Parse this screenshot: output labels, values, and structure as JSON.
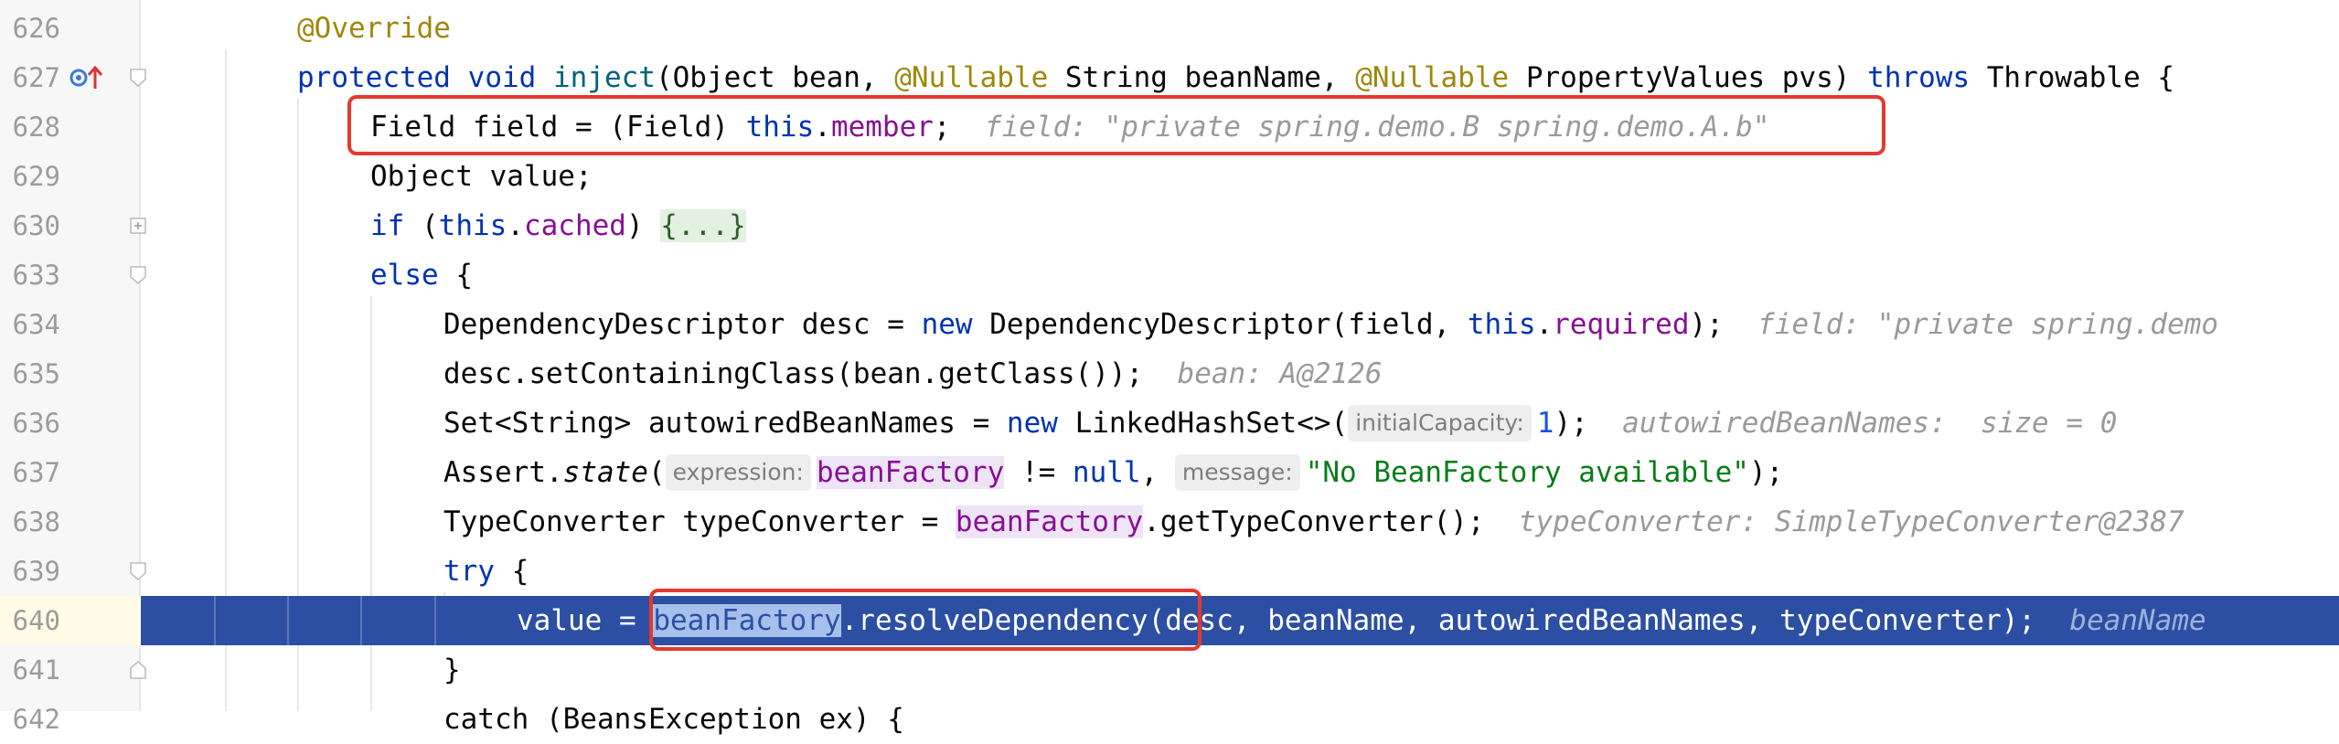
{
  "editor": {
    "lines": [
      {
        "num": "626",
        "text": "@Override"
      },
      {
        "num": "627",
        "kw1": "protected",
        "kw2": "void",
        "method": "inject",
        "p1": "(Object bean, ",
        "ann1": "@Nullable",
        "p2": " String beanName, ",
        "ann2": "@Nullable",
        "p3": " PropertyValues pvs) ",
        "kw3": "throws",
        "p4": " Throwable {"
      },
      {
        "num": "628",
        "p1": "Field field = (Field) ",
        "kw1": "this",
        "p2": ".",
        "fld": "member",
        "p3": ";",
        "hint": "field: \"private spring.demo.B spring.demo.A.b\""
      },
      {
        "num": "629",
        "text": "Object value;"
      },
      {
        "num": "630",
        "kw1": "if",
        "p1": " (",
        "kw2": "this",
        "p2": ".",
        "fld": "cached",
        "p3": ") ",
        "folded": "{...}"
      },
      {
        "num": "633",
        "kw1": "else",
        "p1": " {"
      },
      {
        "num": "634",
        "p1": "DependencyDescriptor desc = ",
        "kw1": "new",
        "p2": " DependencyDescriptor(field, ",
        "kw2": "this",
        "p3": ".",
        "fld": "required",
        "p4": ");",
        "hint": "field: \"private spring.demo"
      },
      {
        "num": "635",
        "p1": "desc.setContainingClass(bean.getClass());",
        "hint": "bean: A@2126"
      },
      {
        "num": "636",
        "p1": "Set<String> autowiredBeanNames = ",
        "kw1": "new",
        "p2": " LinkedHashSet<>(",
        "param": "initialCapacity:",
        "num1": "1",
        "p3": ");",
        "hint": "autowiredBeanNames:  size = 0"
      },
      {
        "num": "637",
        "p1": "Assert.",
        "ital": "state",
        "p2": "(",
        "param1": "expression:",
        "fld": "beanFactory",
        "p3": " != ",
        "kw1": "null",
        "p4": ",",
        "param2": "message:",
        "str": "\"No BeanFactory available\"",
        "p5": ");"
      },
      {
        "num": "638",
        "p1": "TypeConverter typeConverter = ",
        "fld": "beanFactory",
        "p2": ".getTypeConverter();",
        "hint": "typeConverter: SimpleTypeConverter@2387"
      },
      {
        "num": "639",
        "kw1": "try",
        "p1": " {"
      },
      {
        "num": "640",
        "p1": "value = ",
        "sel": "beanFactory",
        "p2": ".resolveDependency(desc, beanName, autowiredBeanNames, typeConverter);",
        "hint": "beanName"
      },
      {
        "num": "641",
        "p1": "}"
      },
      {
        "num": "642",
        "p1": "catch (BeansException ex) {"
      }
    ]
  },
  "colors": {
    "keyword": "#0033b3",
    "annotation": "#9e880d",
    "field": "#871094",
    "current_line": "#2c4fa3",
    "red_box": "#e5392f"
  },
  "icons": {
    "override": "override-up-arrow-icon",
    "bulb": "lightbulb-icon",
    "fold": "fold-marker-icon"
  }
}
